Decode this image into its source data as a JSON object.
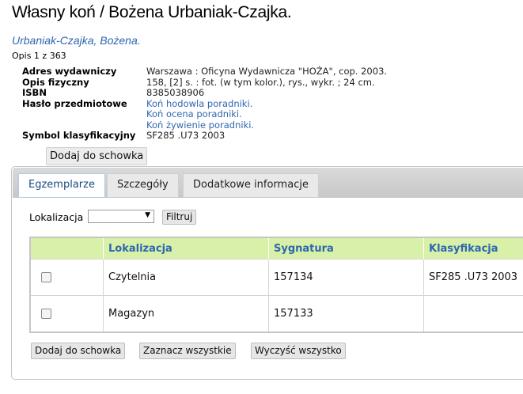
{
  "record": {
    "title": "Własny koń / Bożena Urbaniak-Czajka.",
    "author": "Urbaniak-Czajka, Bożena.",
    "position": "Opis 1 z 363"
  },
  "meta": {
    "publisher_label": "Adres wydawniczy",
    "publisher_value": "Warszawa : Oficyna Wydawnicza \"HOŻA\", cop. 2003.",
    "physical_label": "Opis fizyczny",
    "physical_value": "158, [2] s. : fot. (w tym kolor.), rys., wykr. ; 24 cm.",
    "isbn_label": "ISBN",
    "isbn_value": "8385038906",
    "subjects_label": "Hasło przedmiotowe",
    "subjects": [
      "Koń hodowla poradniki.",
      "Koń ocena poradniki.",
      "Koń żywienie poradniki."
    ],
    "class_label": "Symbol klasyfikacyjny",
    "class_value": "SF285 .U73 2003"
  },
  "add_to_clipboard_top": "Dodaj do schowka",
  "tabs": [
    {
      "label": "Egzemplarze",
      "active": true
    },
    {
      "label": "Szczegóły",
      "active": false
    },
    {
      "label": "Dodatkowe informacje",
      "active": false
    }
  ],
  "filter": {
    "label": "Lokalizacja",
    "selected": "",
    "button": "Filtruj"
  },
  "items_table": {
    "headers": [
      "Lokalizacja",
      "Sygnatura",
      "Klasyfikacja"
    ],
    "rows": [
      {
        "location": "Czytelnia",
        "call_number": "157134",
        "classification": "SF285 .U73 2003",
        "checked": false
      },
      {
        "location": "Magazyn",
        "call_number": "157133",
        "classification": "",
        "checked": false
      }
    ]
  },
  "actions": {
    "add": "Dodaj do schowka",
    "select_all": "Zaznacz wszystkie",
    "clear_all": "Wyczyść wszystko"
  },
  "colors": {
    "link": "#2e66b0",
    "header_bg": "#d9f0a8",
    "button_bg": "#e6e6e6"
  }
}
